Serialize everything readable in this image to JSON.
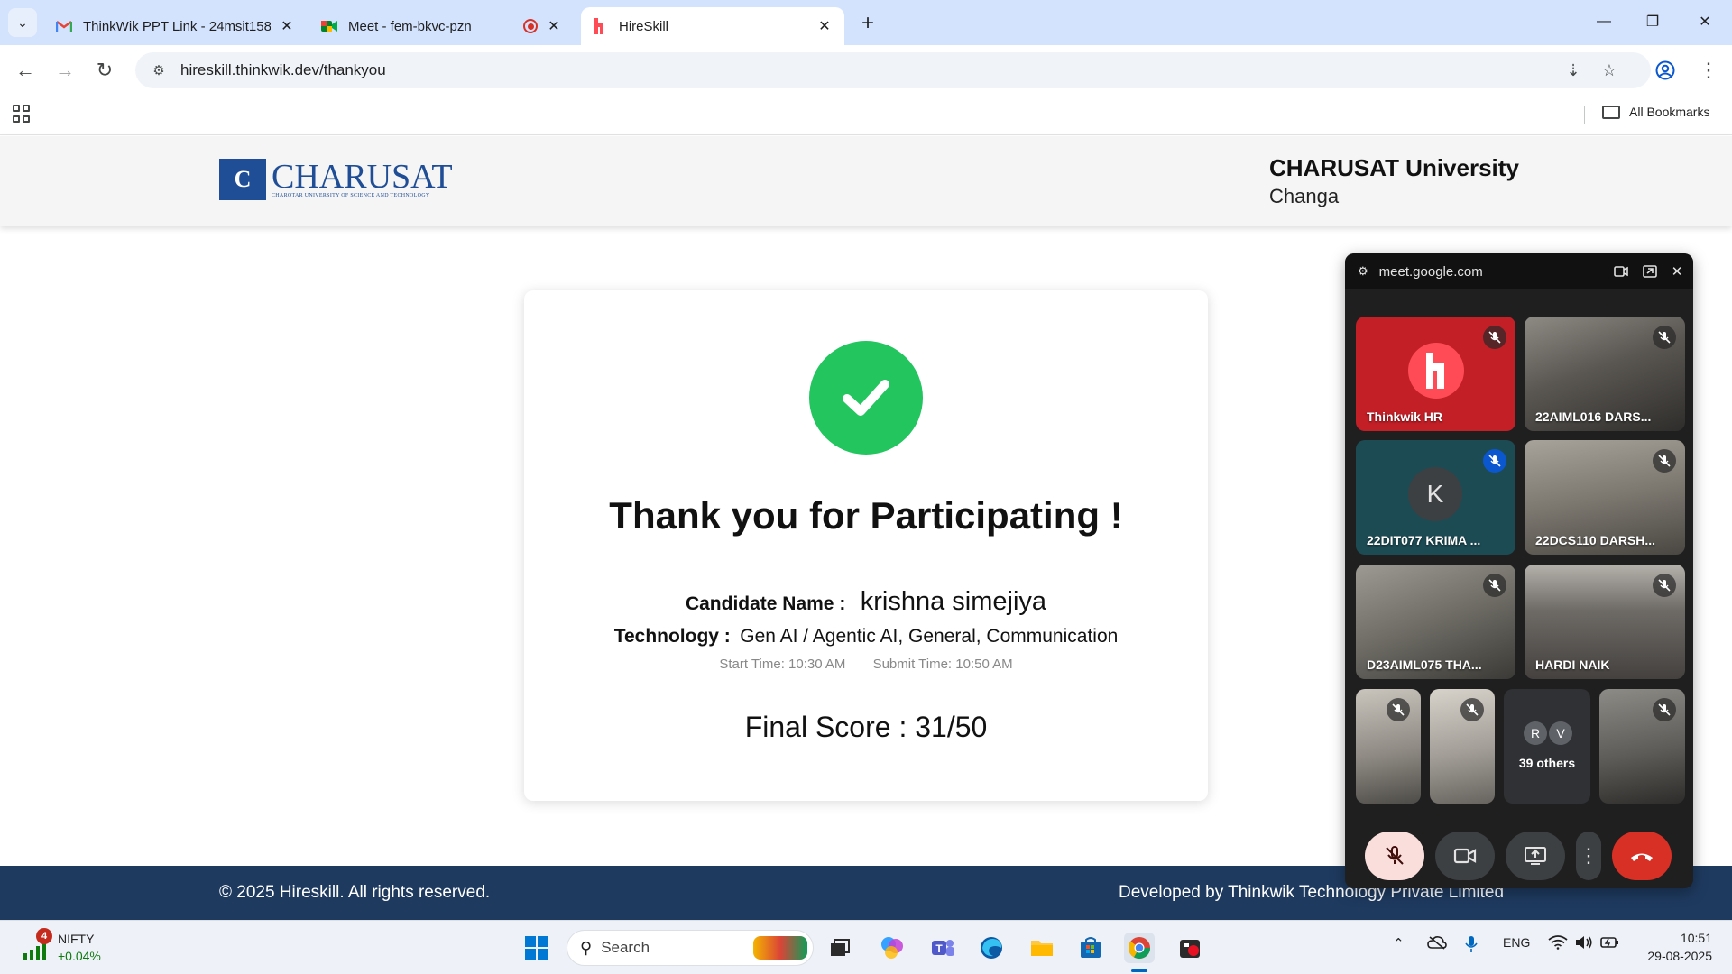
{
  "browser": {
    "tabs": [
      {
        "title": "ThinkWik PPT Link - 24msit158",
        "favicon": "gmail-icon",
        "active": false
      },
      {
        "title": "Meet - fem-bkvc-pzn",
        "favicon": "google-meet-icon",
        "recording": true,
        "active": false
      },
      {
        "title": "HireSkill",
        "favicon": "hireskill-icon",
        "active": true
      }
    ],
    "url": "hireskill.thinkwik.dev/thankyou",
    "bookmarks_label": "All Bookmarks"
  },
  "header": {
    "logo_text": "CHARUSAT",
    "logo_subtitle": "CHAROTAR UNIVERSITY OF SCIENCE AND TECHNOLOGY",
    "logo_mark": "C",
    "university_name": "CHARUSAT University",
    "city": "Changa"
  },
  "card": {
    "title": "Thank you for Participating !",
    "candidate_label": "Candidate Name :",
    "candidate_name": "krishna simejiya",
    "technology_label": "Technology :",
    "technology_value": "Gen AI / Agentic AI, General, Communication",
    "start_time": "Start Time: 10:30 AM",
    "submit_time": "Submit Time: 10:50 AM",
    "final_score": "Final Score : 31/50",
    "success_color": "#22c55e"
  },
  "footer": {
    "copyright": "© 2025 Hireskill. All rights reserved.",
    "developer": "Developed by Thinkwik Technology Private Limited",
    "background_color": "#1e3a5f"
  },
  "meet_pip": {
    "domain": "meet.google.com",
    "participants": [
      {
        "name": "Thinkwik HR",
        "type": "logo"
      },
      {
        "name": "22AIML016 DARS...",
        "type": "video"
      },
      {
        "name": "22DIT077 KRIMA ...",
        "type": "avatar",
        "initial": "K"
      },
      {
        "name": "22DCS110 DARSH...",
        "type": "video"
      },
      {
        "name": "D23AIML075 THA...",
        "type": "video"
      },
      {
        "name": "HARDI NAIK",
        "type": "video"
      }
    ],
    "others": {
      "label": "39 others",
      "initials": [
        "R",
        "V"
      ]
    }
  },
  "taskbar": {
    "nifty_badge": "4",
    "nifty_name": "NIFTY",
    "nifty_change": "+0.04%",
    "search_label": "Search",
    "language": "ENG",
    "time": "10:51",
    "date": "29-08-2025"
  }
}
